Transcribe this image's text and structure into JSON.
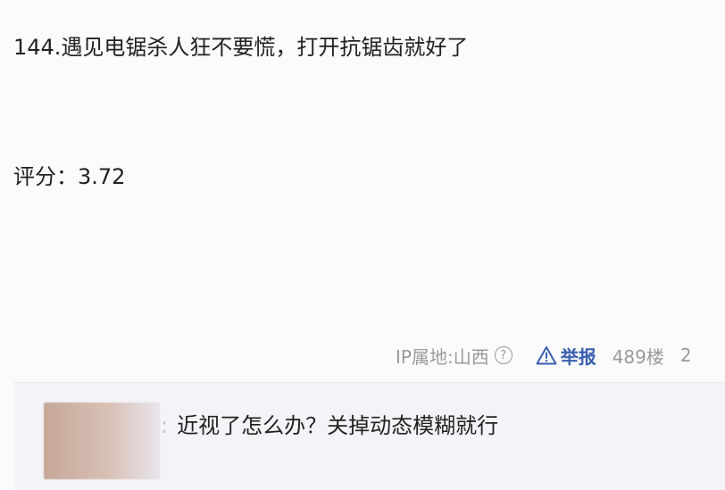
{
  "post": {
    "title": "144.遇见电锯杀人狂不要慌，打开抗锯齿就好了",
    "score": "评分：3.72"
  },
  "meta": {
    "ip_location": "IP属地:山西",
    "help_icon_glyph": "?",
    "report_label": "举报",
    "floor": "489楼",
    "date_partial": "2",
    "icons": {
      "help": "question-circle-icon",
      "report": "warning-triangle-icon"
    },
    "colors": {
      "report": "#3a5fb0",
      "muted": "#9a9a9a"
    }
  },
  "reply": {
    "separator": ":",
    "text": "近视了怎么办？关掉动态模糊就行"
  }
}
